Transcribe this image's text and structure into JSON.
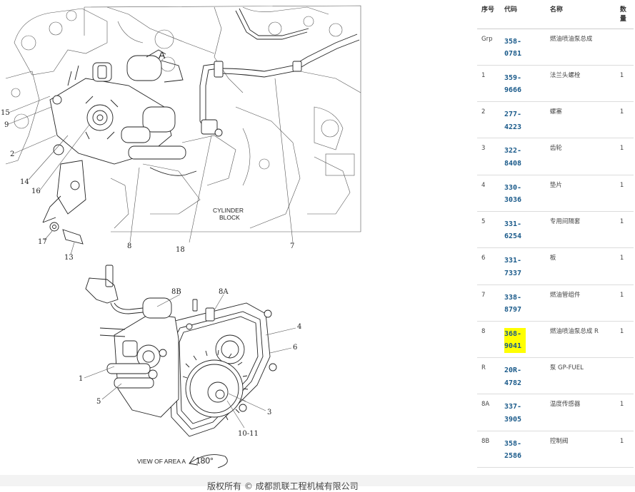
{
  "diagram": {
    "view_label": "VIEW OF AREA A",
    "rotation_label": "180°",
    "area_label": "A",
    "block_label_line1": "CYLINDER",
    "block_label_line2": "BLOCK",
    "top_callouts": [
      "15",
      "9",
      "2",
      "14",
      "16",
      "17",
      "13",
      "8",
      "18",
      "7"
    ],
    "bottom_callouts": [
      "8B",
      "8A",
      "4",
      "6",
      "1",
      "5",
      "3",
      "10-11"
    ]
  },
  "parts_table": {
    "headers": {
      "num": "序号",
      "code": "代码",
      "name": "名称",
      "qty": "数量"
    },
    "rows": [
      {
        "num": "Grp",
        "code": "358-0781",
        "name": "燃油喷油泵总成",
        "qty": "",
        "highlight": false
      },
      {
        "num": "1",
        "code": "359-9666",
        "name": "法兰头螺栓",
        "qty": "1",
        "highlight": false
      },
      {
        "num": "2",
        "code": "277-4223",
        "name": "螺塞",
        "qty": "1",
        "highlight": false
      },
      {
        "num": "3",
        "code": "322-8408",
        "name": "齿轮",
        "qty": "1",
        "highlight": false
      },
      {
        "num": "4",
        "code": "330-3036",
        "name": "垫片",
        "qty": "1",
        "highlight": false
      },
      {
        "num": "5",
        "code": "331-6254",
        "name": "专用间隔套",
        "qty": "1",
        "highlight": false
      },
      {
        "num": "6",
        "code": "331-7337",
        "name": "板",
        "qty": "1",
        "highlight": false
      },
      {
        "num": "7",
        "code": "338-8797",
        "name": "燃油管组件",
        "qty": "1",
        "highlight": false
      },
      {
        "num": "8",
        "code": "368-9041",
        "name": "燃油喷油泵总成 R",
        "qty": "1",
        "highlight": true
      },
      {
        "num": "R",
        "code": "20R-4782",
        "name": "泵 GP-FUEL",
        "qty": "",
        "highlight": false
      },
      {
        "num": "8A",
        "code": "337-3905",
        "name": "温度传感器",
        "qty": "1",
        "highlight": false
      },
      {
        "num": "8B",
        "code": "358-2586",
        "name": "控制阀",
        "qty": "1",
        "highlight": false
      }
    ]
  },
  "footer": {
    "text": "版权所有 © 成都凯联工程机械有限公司"
  }
}
